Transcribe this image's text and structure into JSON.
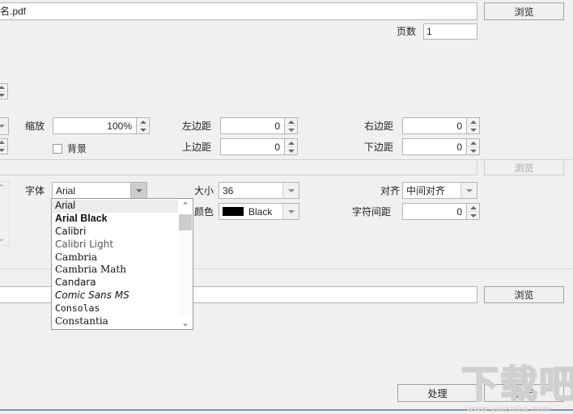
{
  "window": {
    "theme_bg": "#f0f0f0",
    "accent_line": "#7e96a6"
  },
  "top": {
    "file_field_value": "名.pdf",
    "browse_label": "浏览",
    "pages_label": "页数",
    "pages_value": "1"
  },
  "transform": {
    "zoom_label": "缩放",
    "zoom_value": "100%",
    "background_label": "背景",
    "background_checked": false,
    "margin_left_label": "左边距",
    "margin_left_value": "0",
    "margin_top_label": "上边距",
    "margin_top_value": "0",
    "margin_right_label": "右边距",
    "margin_right_value": "0",
    "margin_bottom_label": "下边距",
    "margin_bottom_value": "0"
  },
  "image_row": {
    "path_value": "",
    "browse_label": "浏览",
    "disabled": true
  },
  "text_row": {
    "path_value": "",
    "browse_label": "浏览"
  },
  "font": {
    "font_label": "字体",
    "font_value": "Arial",
    "size_label": "大小",
    "size_value": "36",
    "color_label": "颜色",
    "color_value": "Black",
    "color_hex": "#000000",
    "align_label": "对齐",
    "align_value": "中间对齐",
    "spacing_label": "字符间距",
    "spacing_value": "0"
  },
  "font_dropdown": {
    "selected": "Arial",
    "items": [
      {
        "label": "Arial",
        "style": "f-arial",
        "selected": true
      },
      {
        "label": "Arial Black",
        "style": "f-arialblack",
        "selected": false
      },
      {
        "label": "Calibri",
        "style": "f-calibri",
        "selected": false
      },
      {
        "label": "Calibri Light",
        "style": "f-calibrilight",
        "selected": false
      },
      {
        "label": "Cambria",
        "style": "f-cambria",
        "selected": false
      },
      {
        "label": "Cambria Math",
        "style": "f-cambriamath",
        "selected": false
      },
      {
        "label": "Candara",
        "style": "f-candara",
        "selected": false
      },
      {
        "label": "Comic Sans MS",
        "style": "f-comic",
        "selected": false
      },
      {
        "label": "Consolas",
        "style": "f-consolas",
        "selected": false
      },
      {
        "label": "Constantia",
        "style": "f-constantia",
        "selected": false
      }
    ],
    "scroll_up_icon": "⌃",
    "scroll_down_icon": "⌄"
  },
  "footer": {
    "process_label": "处理",
    "close_label": "关闭"
  },
  "watermark": {
    "brand": "下载吧",
    "url": "www.xiazaiba.com"
  }
}
